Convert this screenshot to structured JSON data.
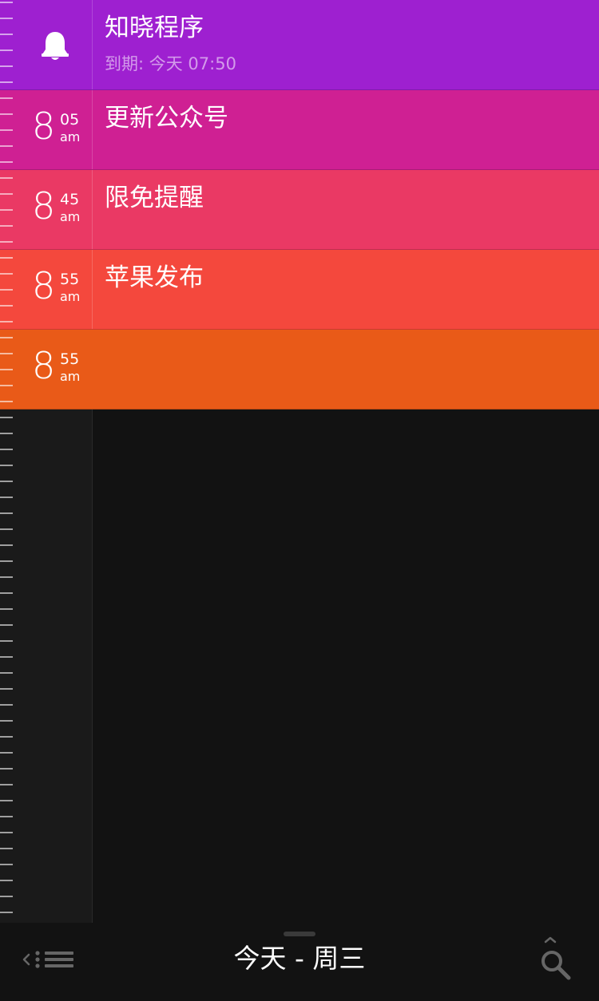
{
  "colors": {
    "row_1": "#9e20d0",
    "row_2": "#cf2093",
    "row_3": "#ea3964",
    "row_4": "#f4483d",
    "row_5": "#e95a18",
    "background": "#121212"
  },
  "tasks": [
    {
      "icon": "bell-icon",
      "title": "知晓程序",
      "subtitle": "到期: 今天 07:50"
    },
    {
      "hour": "8",
      "minute": "05",
      "ampm": "am",
      "title": "更新公众号"
    },
    {
      "hour": "8",
      "minute": "45",
      "ampm": "am",
      "title": "限免提醒"
    },
    {
      "hour": "8",
      "minute": "55",
      "ampm": "am",
      "title": "苹果发布"
    },
    {
      "hour": "8",
      "minute": "55",
      "ampm": "am",
      "title": ""
    }
  ],
  "bottom_bar": {
    "title": "今天 - 周三",
    "left_icon": "list-menu-icon",
    "right_icon": "search-icon"
  }
}
